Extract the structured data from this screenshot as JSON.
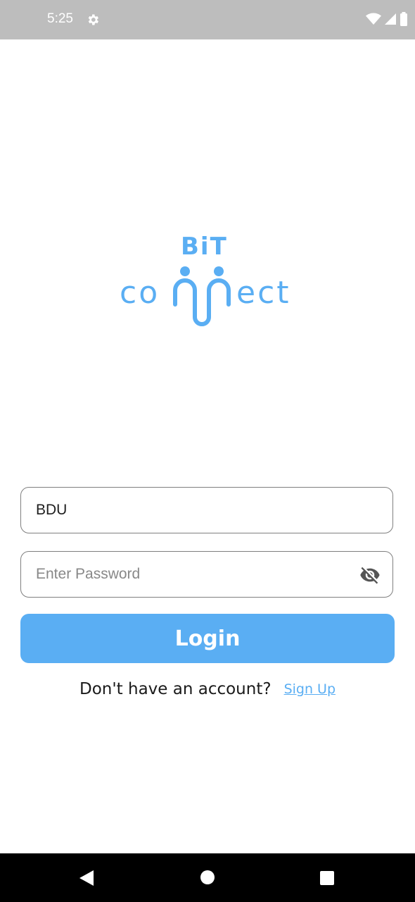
{
  "status_bar": {
    "time": "5:25",
    "icons": [
      "gear-icon",
      "wifi-icon",
      "signal-icon",
      "battery-icon"
    ]
  },
  "logo": {
    "top_text": "BiT",
    "word": "conect",
    "color": "#5aaef3"
  },
  "form": {
    "username_value": "BDU",
    "password_placeholder": "Enter Password",
    "password_toggle_icon": "eye-off-icon",
    "login_label": "Login"
  },
  "signup": {
    "prompt": "Don't have an account?",
    "link_label": "Sign Up"
  },
  "colors": {
    "accent": "#5aaef3",
    "status_bar": "#bdbdbd",
    "nav_bar": "#000000"
  },
  "nav_bar": {
    "icons": [
      "back-icon",
      "home-icon",
      "recent-apps-icon"
    ]
  }
}
